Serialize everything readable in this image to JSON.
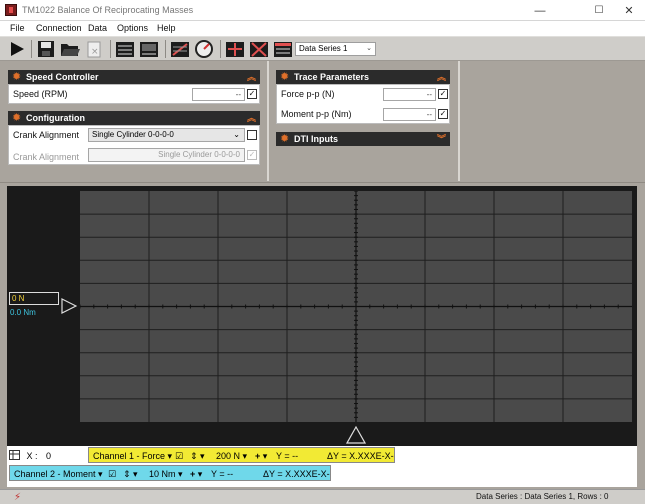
{
  "window": {
    "title": "TM1022 Balance Of Reciprocating Masses",
    "minimize": "—",
    "maximize": "☐",
    "close": "✕"
  },
  "menu": [
    "File",
    "Connection",
    "Data",
    "Options",
    "Help"
  ],
  "toolbar": {
    "series_select": "Data Series 1",
    "icons": [
      "run-icon",
      "save-icon",
      "open-folder-icon",
      "delete-file-icon",
      "table-view-icon",
      "chart-view-icon",
      "calibrate-icon",
      "gauge-icon",
      "add-marker-icon",
      "remove-marker-icon",
      "grid-table-icon"
    ]
  },
  "speed_controller": {
    "title": "Speed Controller",
    "speed_label": "Speed (RPM)",
    "speed_value": "--",
    "speed_checked": true
  },
  "configuration": {
    "title": "Configuration",
    "crank_label": "Crank Alignment",
    "crank_value": "Single Cylinder 0-0-0-0",
    "crank_checked": false,
    "crank_label2": "Crank Alignment",
    "crank_value2": "Single Cylinder 0-0-0-0"
  },
  "trace_parameters": {
    "title": "Trace Parameters",
    "force_label": "Force p-p  (N)",
    "force_value": "--",
    "moment_label": "Moment p-p  (Nm)",
    "moment_value": "--"
  },
  "dti_inputs": {
    "title": "DTI Inputs"
  },
  "scope": {
    "force_marker": "0 N",
    "moment_marker": "0.0 Nm",
    "grid_cols": 8,
    "grid_rows": 10
  },
  "channels": {
    "x_label": "X :",
    "x_value": "0",
    "ch1": {
      "name": "Channel 1 - Force",
      "scale": "200 N",
      "y": "Y = --",
      "dy": "ΔY = X.XXXE-X-"
    },
    "ch2": {
      "name": "Channel 2 - Moment",
      "scale": "10 Nm",
      "y": "Y = --",
      "dy": "ΔY = X.XXXE-X-"
    }
  },
  "status": {
    "text": "Data Series : Data Series 1,   Rows : 0"
  },
  "colors": {
    "force": "#f2ea34",
    "moment": "#6fd8ea",
    "accent": "#e0702a"
  }
}
